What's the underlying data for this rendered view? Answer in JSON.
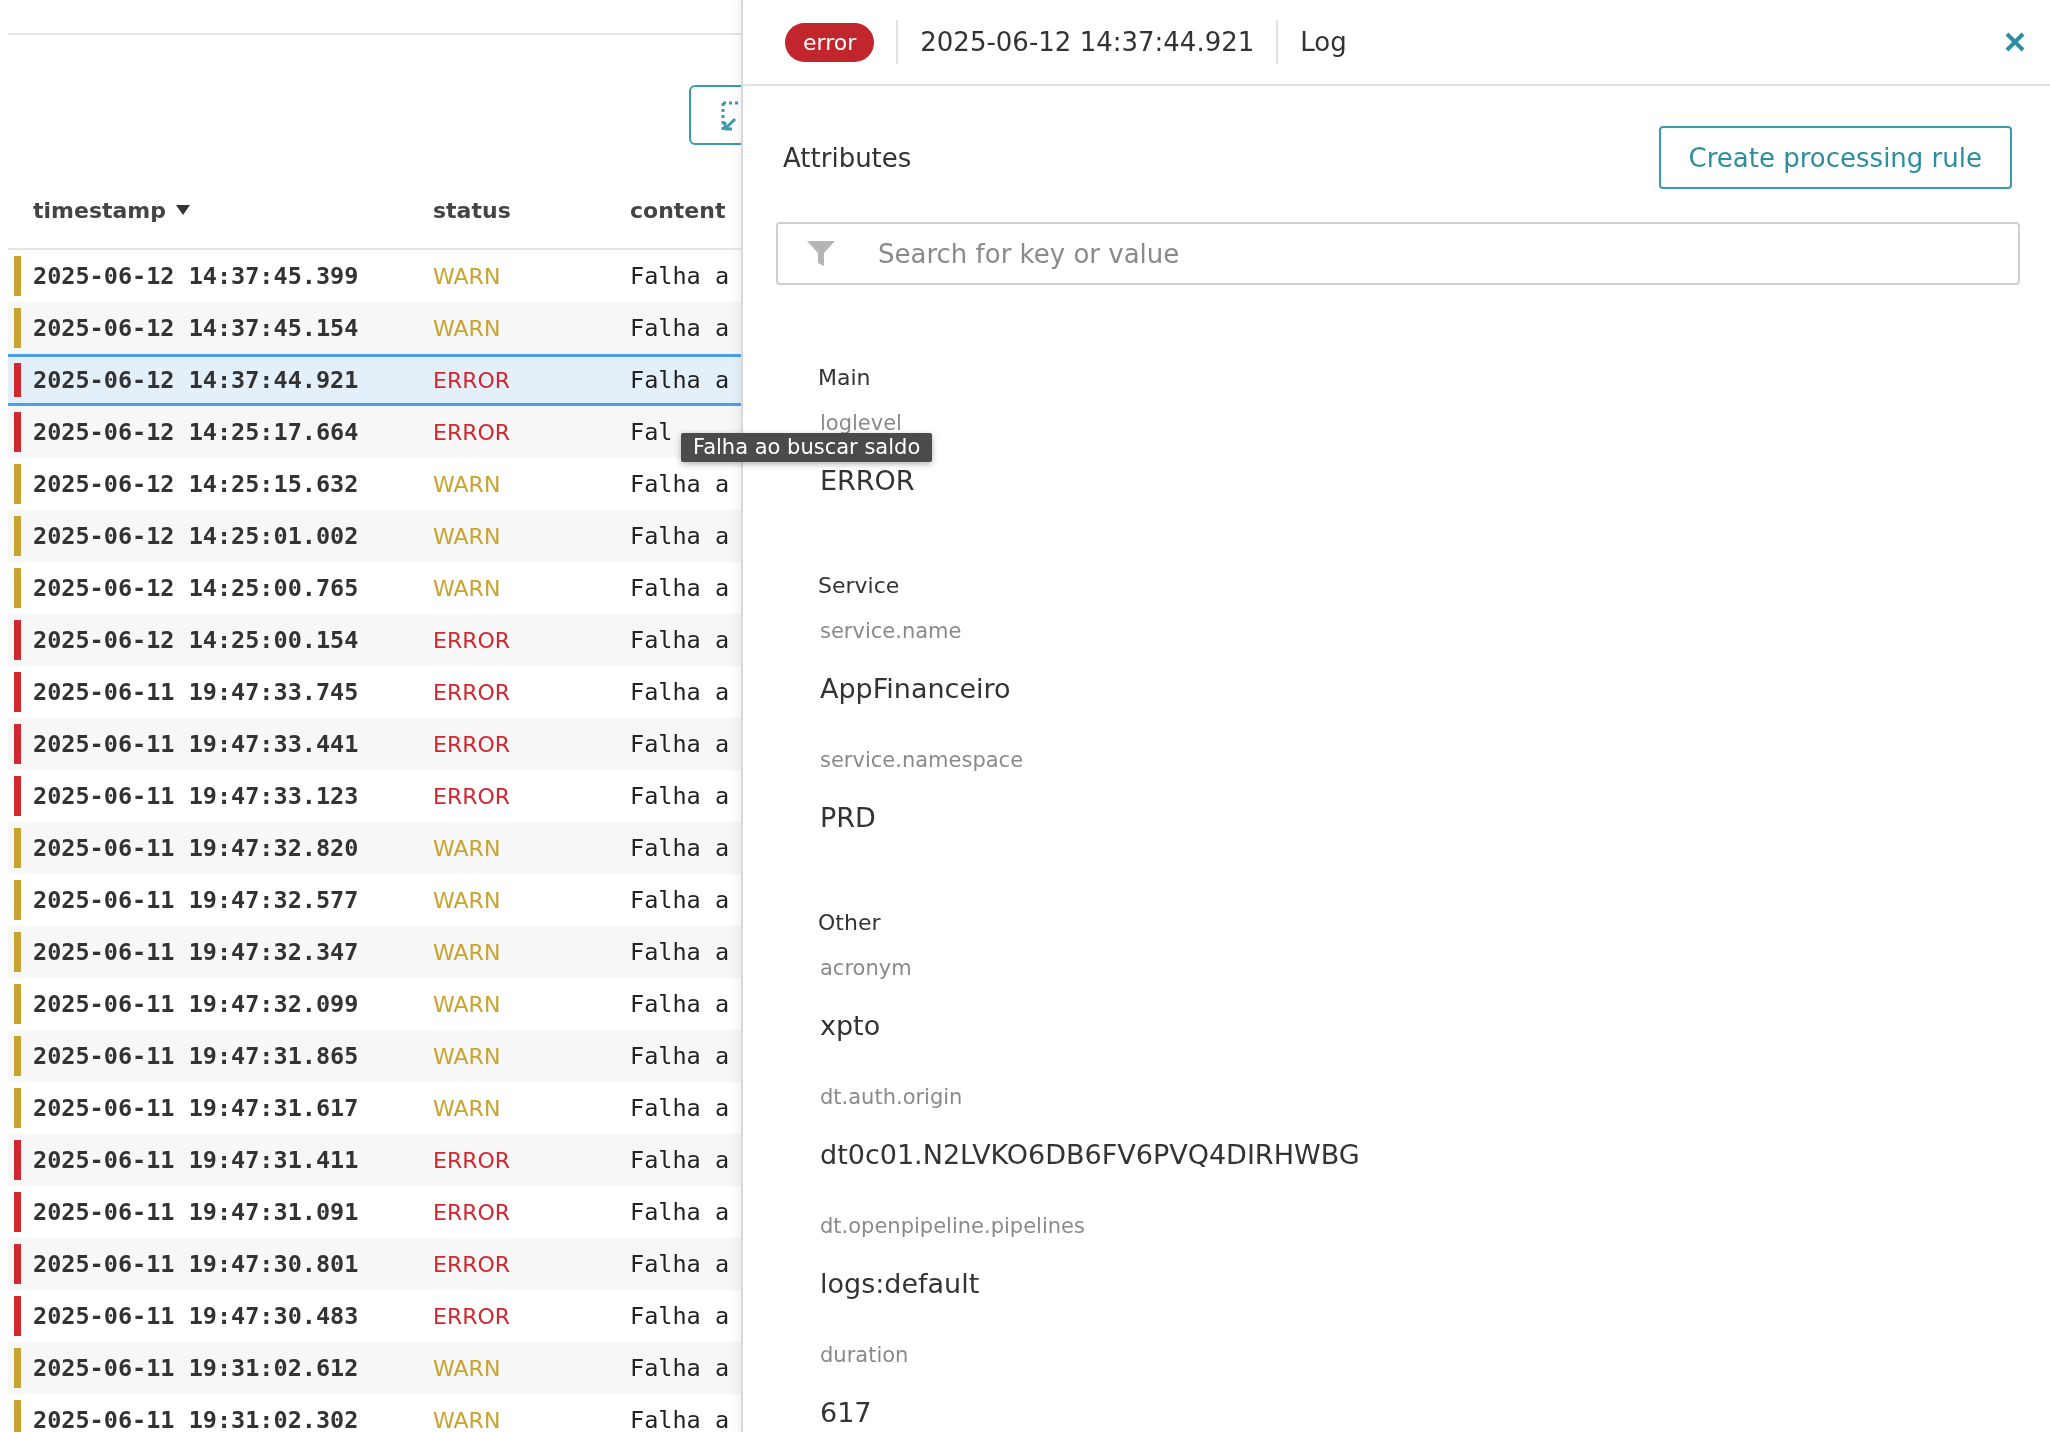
{
  "log_table": {
    "columns": [
      {
        "label": "timestamp",
        "sorted": true
      },
      {
        "label": "status",
        "sorted": false
      },
      {
        "label": "content",
        "sorted": false
      }
    ],
    "rows": [
      {
        "timestamp": "2025-06-12 14:37:45.399",
        "status": "WARN",
        "kind": "warn",
        "content": "Falha a",
        "selected": false
      },
      {
        "timestamp": "2025-06-12 14:37:45.154",
        "status": "WARN",
        "kind": "warn",
        "content": "Falha a",
        "selected": false
      },
      {
        "timestamp": "2025-06-12 14:37:44.921",
        "status": "ERROR",
        "kind": "error",
        "content": "Falha a",
        "selected": true
      },
      {
        "timestamp": "2025-06-12 14:25:17.664",
        "status": "ERROR",
        "kind": "error",
        "content": "Fal",
        "selected": false
      },
      {
        "timestamp": "2025-06-12 14:25:15.632",
        "status": "WARN",
        "kind": "warn",
        "content": "Falha a",
        "selected": false
      },
      {
        "timestamp": "2025-06-12 14:25:01.002",
        "status": "WARN",
        "kind": "warn",
        "content": "Falha a",
        "selected": false
      },
      {
        "timestamp": "2025-06-12 14:25:00.765",
        "status": "WARN",
        "kind": "warn",
        "content": "Falha a",
        "selected": false
      },
      {
        "timestamp": "2025-06-12 14:25:00.154",
        "status": "ERROR",
        "kind": "error",
        "content": "Falha a",
        "selected": false
      },
      {
        "timestamp": "2025-06-11 19:47:33.745",
        "status": "ERROR",
        "kind": "error",
        "content": "Falha a",
        "selected": false
      },
      {
        "timestamp": "2025-06-11 19:47:33.441",
        "status": "ERROR",
        "kind": "error",
        "content": "Falha a",
        "selected": false
      },
      {
        "timestamp": "2025-06-11 19:47:33.123",
        "status": "ERROR",
        "kind": "error",
        "content": "Falha a",
        "selected": false
      },
      {
        "timestamp": "2025-06-11 19:47:32.820",
        "status": "WARN",
        "kind": "warn",
        "content": "Falha a",
        "selected": false
      },
      {
        "timestamp": "2025-06-11 19:47:32.577",
        "status": "WARN",
        "kind": "warn",
        "content": "Falha a",
        "selected": false
      },
      {
        "timestamp": "2025-06-11 19:47:32.347",
        "status": "WARN",
        "kind": "warn",
        "content": "Falha a",
        "selected": false
      },
      {
        "timestamp": "2025-06-11 19:47:32.099",
        "status": "WARN",
        "kind": "warn",
        "content": "Falha a",
        "selected": false
      },
      {
        "timestamp": "2025-06-11 19:47:31.865",
        "status": "WARN",
        "kind": "warn",
        "content": "Falha a",
        "selected": false
      },
      {
        "timestamp": "2025-06-11 19:47:31.617",
        "status": "WARN",
        "kind": "warn",
        "content": "Falha a",
        "selected": false
      },
      {
        "timestamp": "2025-06-11 19:47:31.411",
        "status": "ERROR",
        "kind": "error",
        "content": "Falha a",
        "selected": false
      },
      {
        "timestamp": "2025-06-11 19:47:31.091",
        "status": "ERROR",
        "kind": "error",
        "content": "Falha a",
        "selected": false
      },
      {
        "timestamp": "2025-06-11 19:47:30.801",
        "status": "ERROR",
        "kind": "error",
        "content": "Falha a",
        "selected": false
      },
      {
        "timestamp": "2025-06-11 19:47:30.483",
        "status": "ERROR",
        "kind": "error",
        "content": "Falha a",
        "selected": false
      },
      {
        "timestamp": "2025-06-11 19:31:02.612",
        "status": "WARN",
        "kind": "warn",
        "content": "Falha a",
        "selected": false
      },
      {
        "timestamp": "2025-06-11 19:31:02.302",
        "status": "WARN",
        "kind": "warn",
        "content": "Falha a",
        "selected": false
      }
    ]
  },
  "tooltip": "Falha ao buscar saldo",
  "detail_panel": {
    "badge": {
      "label": "error",
      "kind": "error"
    },
    "timestamp": "2025-06-12 14:37:44.921",
    "type": "Log",
    "attributes_title": "Attributes",
    "create_button": "Create processing rule",
    "search": {
      "placeholder": "Search for key or value"
    },
    "sections": [
      {
        "title": "Main",
        "attributes": [
          {
            "key": "loglevel",
            "value": "ERROR"
          }
        ]
      },
      {
        "title": "Service",
        "attributes": [
          {
            "key": "service.name",
            "value": "AppFinanceiro"
          },
          {
            "key": "service.namespace",
            "value": "PRD"
          }
        ]
      },
      {
        "title": "Other",
        "attributes": [
          {
            "key": "acronym",
            "value": "xpto"
          },
          {
            "key": "dt.auth.origin",
            "value": "dt0c01.N2LVKO6DB6FV6PVQ4DIRHWBG"
          },
          {
            "key": "dt.openpipeline.pipelines",
            "value": "logs:default"
          },
          {
            "key": "duration",
            "value": "617"
          }
        ]
      }
    ]
  }
}
